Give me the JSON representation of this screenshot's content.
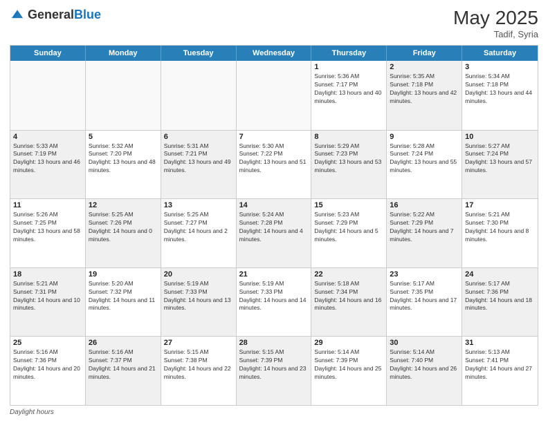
{
  "header": {
    "logo": {
      "general": "General",
      "blue": "Blue"
    },
    "month_year": "May 2025",
    "location": "Tadif, Syria"
  },
  "calendar": {
    "days_of_week": [
      "Sunday",
      "Monday",
      "Tuesday",
      "Wednesday",
      "Thursday",
      "Friday",
      "Saturday"
    ],
    "weeks": [
      [
        {
          "day": "",
          "empty": true
        },
        {
          "day": "",
          "empty": true
        },
        {
          "day": "",
          "empty": true
        },
        {
          "day": "",
          "empty": true
        },
        {
          "day": "1",
          "sunrise": "5:36 AM",
          "sunset": "7:17 PM",
          "daylight": "13 hours and 40 minutes.",
          "shaded": false
        },
        {
          "day": "2",
          "sunrise": "5:35 AM",
          "sunset": "7:18 PM",
          "daylight": "13 hours and 42 minutes.",
          "shaded": true
        },
        {
          "day": "3",
          "sunrise": "5:34 AM",
          "sunset": "7:18 PM",
          "daylight": "13 hours and 44 minutes.",
          "shaded": false
        }
      ],
      [
        {
          "day": "4",
          "sunrise": "5:33 AM",
          "sunset": "7:19 PM",
          "daylight": "13 hours and 46 minutes.",
          "shaded": true
        },
        {
          "day": "5",
          "sunrise": "5:32 AM",
          "sunset": "7:20 PM",
          "daylight": "13 hours and 48 minutes.",
          "shaded": false
        },
        {
          "day": "6",
          "sunrise": "5:31 AM",
          "sunset": "7:21 PM",
          "daylight": "13 hours and 49 minutes.",
          "shaded": true
        },
        {
          "day": "7",
          "sunrise": "5:30 AM",
          "sunset": "7:22 PM",
          "daylight": "13 hours and 51 minutes.",
          "shaded": false
        },
        {
          "day": "8",
          "sunrise": "5:29 AM",
          "sunset": "7:23 PM",
          "daylight": "13 hours and 53 minutes.",
          "shaded": true
        },
        {
          "day": "9",
          "sunrise": "5:28 AM",
          "sunset": "7:24 PM",
          "daylight": "13 hours and 55 minutes.",
          "shaded": false
        },
        {
          "day": "10",
          "sunrise": "5:27 AM",
          "sunset": "7:24 PM",
          "daylight": "13 hours and 57 minutes.",
          "shaded": true
        }
      ],
      [
        {
          "day": "11",
          "sunrise": "5:26 AM",
          "sunset": "7:25 PM",
          "daylight": "13 hours and 58 minutes.",
          "shaded": false
        },
        {
          "day": "12",
          "sunrise": "5:25 AM",
          "sunset": "7:26 PM",
          "daylight": "14 hours and 0 minutes.",
          "shaded": true
        },
        {
          "day": "13",
          "sunrise": "5:25 AM",
          "sunset": "7:27 PM",
          "daylight": "14 hours and 2 minutes.",
          "shaded": false
        },
        {
          "day": "14",
          "sunrise": "5:24 AM",
          "sunset": "7:28 PM",
          "daylight": "14 hours and 4 minutes.",
          "shaded": true
        },
        {
          "day": "15",
          "sunrise": "5:23 AM",
          "sunset": "7:29 PM",
          "daylight": "14 hours and 5 minutes.",
          "shaded": false
        },
        {
          "day": "16",
          "sunrise": "5:22 AM",
          "sunset": "7:29 PM",
          "daylight": "14 hours and 7 minutes.",
          "shaded": true
        },
        {
          "day": "17",
          "sunrise": "5:21 AM",
          "sunset": "7:30 PM",
          "daylight": "14 hours and 8 minutes.",
          "shaded": false
        }
      ],
      [
        {
          "day": "18",
          "sunrise": "5:21 AM",
          "sunset": "7:31 PM",
          "daylight": "14 hours and 10 minutes.",
          "shaded": true
        },
        {
          "day": "19",
          "sunrise": "5:20 AM",
          "sunset": "7:32 PM",
          "daylight": "14 hours and 11 minutes.",
          "shaded": false
        },
        {
          "day": "20",
          "sunrise": "5:19 AM",
          "sunset": "7:33 PM",
          "daylight": "14 hours and 13 minutes.",
          "shaded": true
        },
        {
          "day": "21",
          "sunrise": "5:19 AM",
          "sunset": "7:33 PM",
          "daylight": "14 hours and 14 minutes.",
          "shaded": false
        },
        {
          "day": "22",
          "sunrise": "5:18 AM",
          "sunset": "7:34 PM",
          "daylight": "14 hours and 16 minutes.",
          "shaded": true
        },
        {
          "day": "23",
          "sunrise": "5:17 AM",
          "sunset": "7:35 PM",
          "daylight": "14 hours and 17 minutes.",
          "shaded": false
        },
        {
          "day": "24",
          "sunrise": "5:17 AM",
          "sunset": "7:36 PM",
          "daylight": "14 hours and 18 minutes.",
          "shaded": true
        }
      ],
      [
        {
          "day": "25",
          "sunrise": "5:16 AM",
          "sunset": "7:36 PM",
          "daylight": "14 hours and 20 minutes.",
          "shaded": false
        },
        {
          "day": "26",
          "sunrise": "5:16 AM",
          "sunset": "7:37 PM",
          "daylight": "14 hours and 21 minutes.",
          "shaded": true
        },
        {
          "day": "27",
          "sunrise": "5:15 AM",
          "sunset": "7:38 PM",
          "daylight": "14 hours and 22 minutes.",
          "shaded": false
        },
        {
          "day": "28",
          "sunrise": "5:15 AM",
          "sunset": "7:39 PM",
          "daylight": "14 hours and 23 minutes.",
          "shaded": true
        },
        {
          "day": "29",
          "sunrise": "5:14 AM",
          "sunset": "7:39 PM",
          "daylight": "14 hours and 25 minutes.",
          "shaded": false
        },
        {
          "day": "30",
          "sunrise": "5:14 AM",
          "sunset": "7:40 PM",
          "daylight": "14 hours and 26 minutes.",
          "shaded": true
        },
        {
          "day": "31",
          "sunrise": "5:13 AM",
          "sunset": "7:41 PM",
          "daylight": "14 hours and 27 minutes.",
          "shaded": false
        }
      ]
    ]
  },
  "footer": {
    "label": "Daylight hours"
  }
}
